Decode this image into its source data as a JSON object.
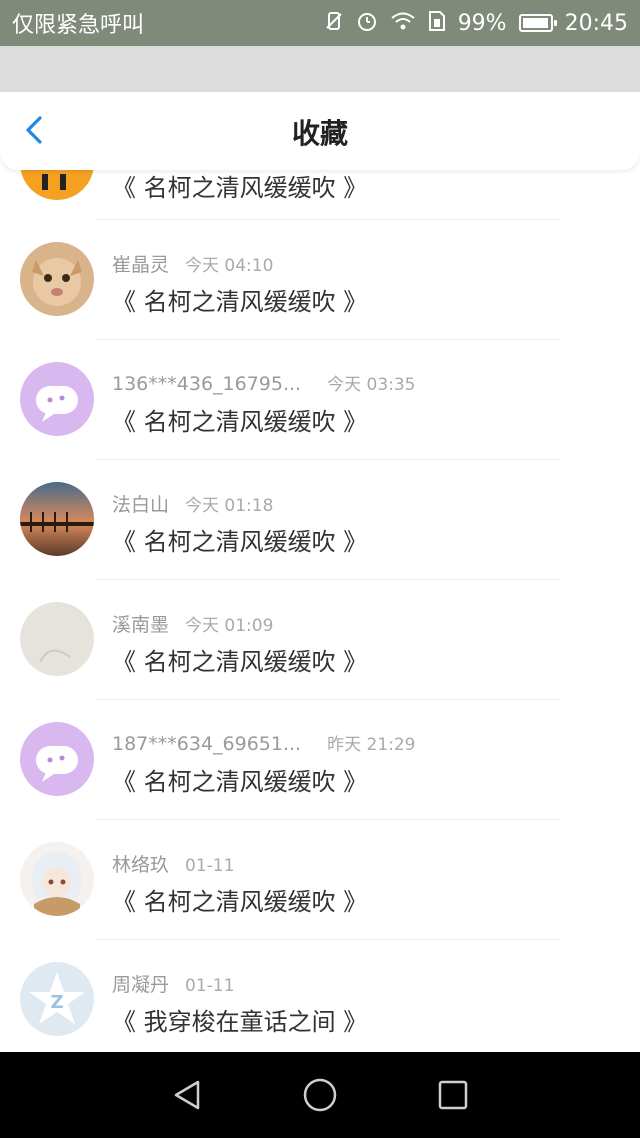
{
  "status_bar": {
    "carrier": "仅限紧急呼叫",
    "battery": "99%",
    "time": "20:45",
    "battery_level": 0.99
  },
  "header": {
    "title": "收藏",
    "back_icon": "chevron-left-icon"
  },
  "first_item": {
    "book": "《 名柯之清风缓缓吹 》"
  },
  "items": [
    {
      "name": "崔晶灵",
      "time": "今天 04:10",
      "book": "《 名柯之清风缓缓吹 》",
      "avatar": "cat-photo"
    },
    {
      "name": "136***436_16795...",
      "time": "今天 03:35",
      "book": "《 名柯之清风缓缓吹 》",
      "avatar": "default-chat"
    },
    {
      "name": "法白山",
      "time": "今天 01:18",
      "book": "《 名柯之清风缓缓吹 》",
      "avatar": "sunset-photo"
    },
    {
      "name": "溪南墨",
      "time": "今天 01:09",
      "book": "《 名柯之清风缓缓吹 》",
      "avatar": "light-photo"
    },
    {
      "name": "187***634_69651...",
      "time": "昨天 21:29",
      "book": "《 名柯之清风缓缓吹 》",
      "avatar": "default-chat"
    },
    {
      "name": "林络玖",
      "time": "01-11",
      "book": "《 名柯之清风缓缓吹 》",
      "avatar": "anime-girl"
    },
    {
      "name": "周凝丹",
      "time": "01-11",
      "book": "《 我穿梭在童话之间 》",
      "avatar": "qq-star"
    }
  ],
  "colors": {
    "accent": "#1e88e5",
    "chat_avatar": "#d9b8ef"
  }
}
